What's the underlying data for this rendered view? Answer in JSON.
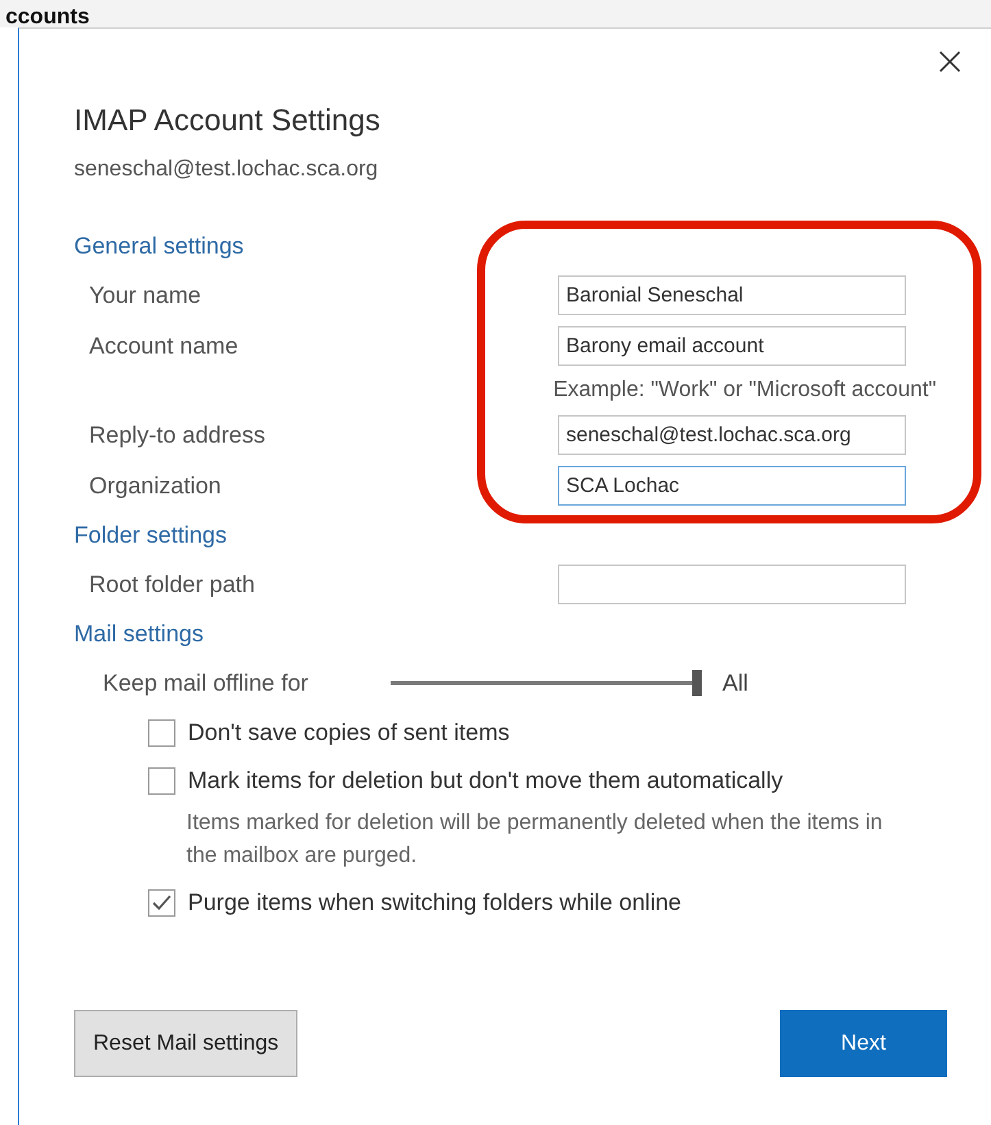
{
  "background": {
    "heading": "ccounts"
  },
  "dialog": {
    "title": "IMAP Account Settings",
    "subtitle": "seneschal@test.lochac.sca.org",
    "sections": [
      {
        "heading": "General settings",
        "rows": [
          {
            "kind": "field",
            "label": "Your name",
            "value": "Baronial Seneschal",
            "focused": false
          },
          {
            "kind": "field",
            "label": "Account name",
            "value": "Barony email account",
            "focused": false
          },
          {
            "kind": "hint",
            "text": "Example: \"Work\" or \"Microsoft account\""
          },
          {
            "kind": "field",
            "label": "Reply-to address",
            "value": "seneschal@test.lochac.sca.org",
            "focused": false
          },
          {
            "kind": "field",
            "label": "Organization",
            "value": "SCA Lochac",
            "focused": true
          }
        ]
      },
      {
        "heading": "Folder settings",
        "rows": [
          {
            "kind": "field",
            "label": "Root folder path",
            "focused": false
          }
        ]
      },
      {
        "heading": "Mail settings",
        "rows": [
          {
            "kind": "slider",
            "label": "Keep mail offline for",
            "level": 1,
            "reading": "All"
          },
          {
            "kind": "checkbox",
            "label": "Don't save copies of sent items",
            "checked": false
          },
          {
            "kind": "checkbox",
            "label": "Mark items for deletion but don't move them automatically",
            "checked": false
          },
          {
            "kind": "note",
            "text": "Items marked for deletion will be permanently deleted when the items in the mailbox are purged."
          },
          {
            "kind": "checkbox",
            "label": "Purge items when switching folders while online",
            "checked": true
          }
        ]
      }
    ],
    "buttons": [
      {
        "kind": "secondary",
        "label": "Reset Mail settings"
      },
      {
        "kind": "primary",
        "label": "Next"
      }
    ]
  }
}
